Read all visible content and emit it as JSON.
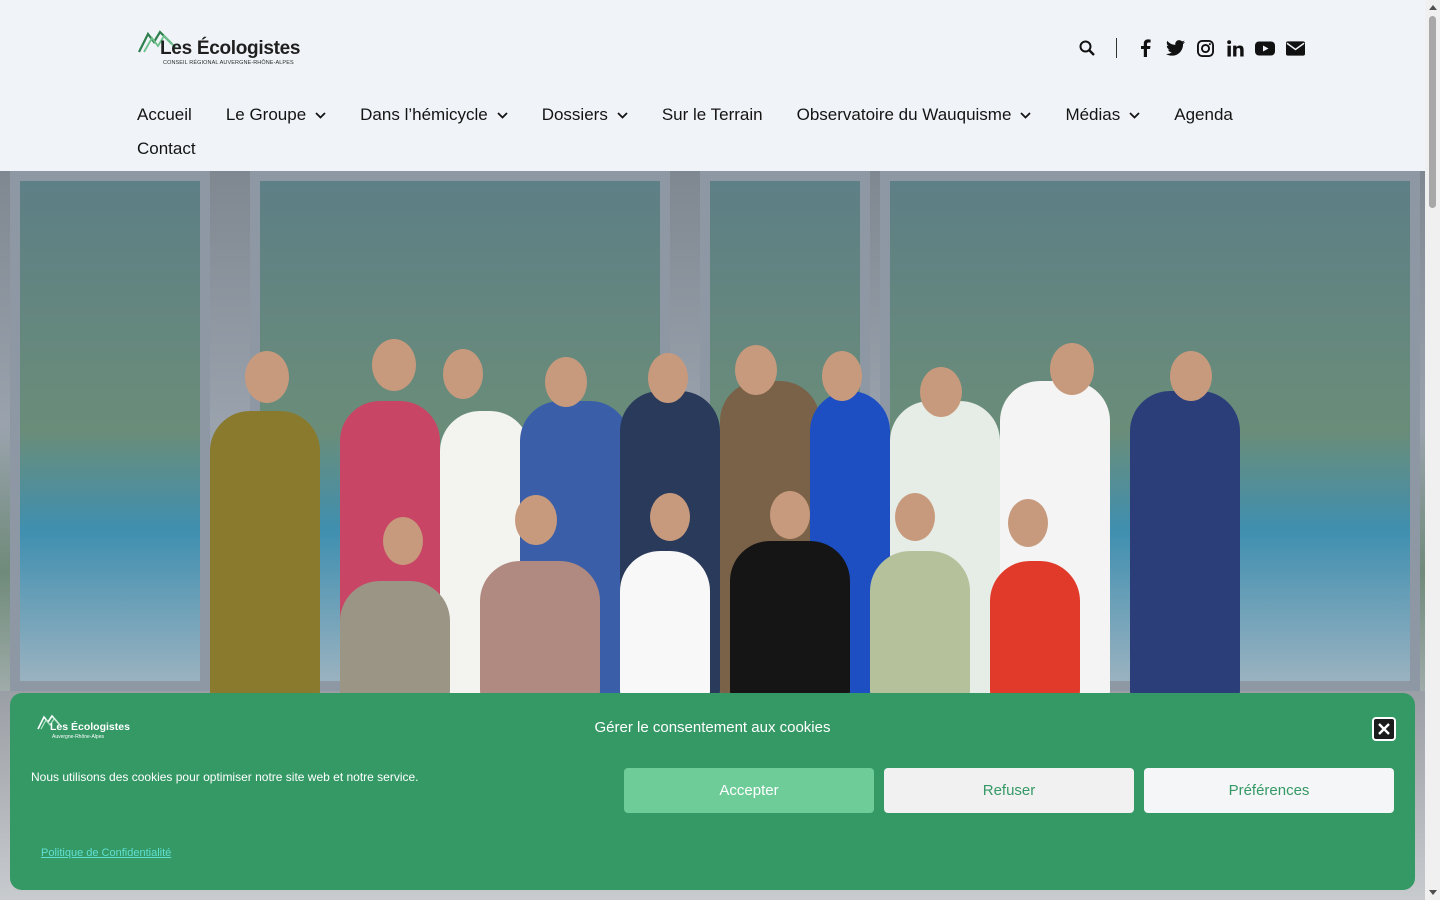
{
  "header": {
    "logo": {
      "name": "Les Écologistes",
      "subtitle": "CONSEIL RÉGIONAL AUVERGNE-RHÔNE-ALPES"
    },
    "tools": {
      "search_icon": "search-icon",
      "social": [
        "facebook-icon",
        "twitter-icon",
        "instagram-icon",
        "linkedin-icon",
        "youtube-icon",
        "email-icon"
      ]
    }
  },
  "nav": {
    "items": [
      {
        "label": "Accueil",
        "has_dropdown": false
      },
      {
        "label": "Le Groupe",
        "has_dropdown": true
      },
      {
        "label": "Dans l’hémicycle",
        "has_dropdown": true
      },
      {
        "label": "Dossiers",
        "has_dropdown": true
      },
      {
        "label": "Sur le Terrain",
        "has_dropdown": false
      },
      {
        "label": "Observatoire du Wauquisme",
        "has_dropdown": true
      },
      {
        "label": "Médias",
        "has_dropdown": true
      },
      {
        "label": "Agenda",
        "has_dropdown": false
      },
      {
        "label": "Contact",
        "has_dropdown": false
      }
    ]
  },
  "cookie": {
    "logo": {
      "name": "Les Écologistes",
      "subtitle": "Auvergne-Rhône-Alpes"
    },
    "title": "Gérer le consentement aux cookies",
    "text": "Nous utilisons des cookies pour optimiser notre site web et notre service.",
    "accept": "Accepter",
    "refuse": "Refuser",
    "preferences": "Préférences",
    "policy_link": "Politique de Confidentialité"
  },
  "colors": {
    "brand_green": "#359966",
    "accept_green": "#6ecc98",
    "policy_link": "#5fe0d2",
    "header_bg": "#f0f4f8"
  }
}
